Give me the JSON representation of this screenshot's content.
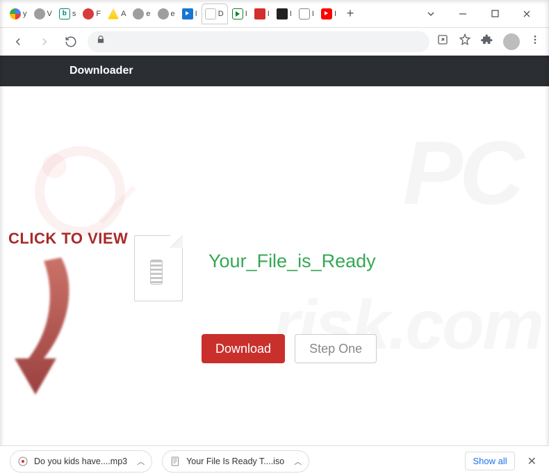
{
  "window": {
    "tabs": [
      {
        "letter": "y"
      },
      {
        "letter": "V"
      },
      {
        "letter": "s"
      },
      {
        "letter": "F"
      },
      {
        "letter": "A"
      },
      {
        "letter": "e"
      },
      {
        "letter": "e"
      },
      {
        "letter": "I"
      },
      {
        "letter": "D"
      },
      {
        "letter": "I"
      },
      {
        "letter": "I"
      },
      {
        "letter": "I"
      },
      {
        "letter": "I"
      },
      {
        "letter": "I"
      }
    ],
    "new_tab": "+"
  },
  "page": {
    "header": "Downloader",
    "click_to_view": "CLICK TO VIEW",
    "file_title": "Your_File_is_Ready",
    "buttons": {
      "download": "Download",
      "step_one": "Step One"
    }
  },
  "downloads": {
    "item1": "Do you kids have....mp3",
    "item2": "Your File Is Ready T....iso",
    "show_all": "Show all"
  },
  "watermark": {
    "line1": "PC",
    "line2": "risk.com"
  }
}
